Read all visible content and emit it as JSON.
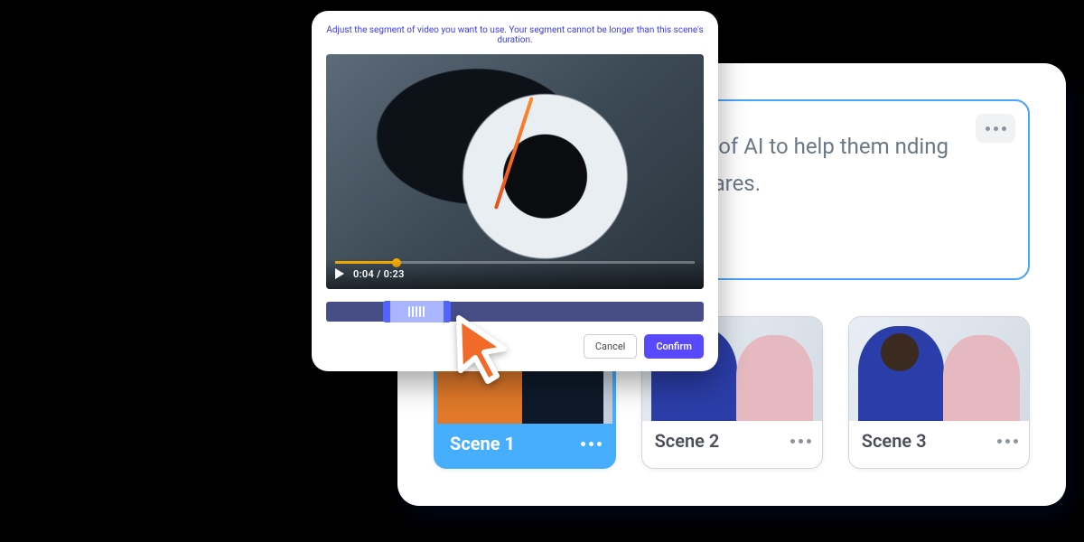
{
  "script_panel": {
    "body_text": "creators and digital power of AI to help them nding hours learning the g softwares."
  },
  "scenes": [
    {
      "label": "Scene 1",
      "selected": true
    },
    {
      "label": "Scene 2",
      "selected": false
    },
    {
      "label": "Scene 3",
      "selected": false
    }
  ],
  "trim_dialog": {
    "help_text": "Adjust the segment of video you want to use. Your segment cannot be longer than this scene's duration.",
    "time_current": "0:04",
    "time_total": "0:23",
    "time_separator": " / ",
    "seek_progress_pct": 17,
    "trim_left_pct": 15,
    "trim_width_pct": 18,
    "cancel_label": "Cancel",
    "confirm_label": "Confirm"
  }
}
